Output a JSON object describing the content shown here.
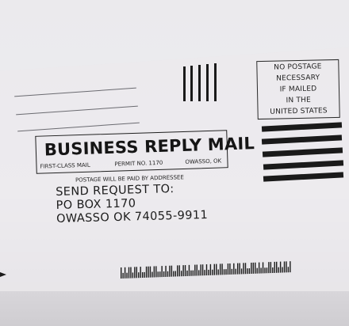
{
  "postage_box": {
    "lines": [
      "NO POSTAGE",
      "NECESSARY",
      "IF MAILED",
      "IN THE",
      "UNITED STATES"
    ]
  },
  "brm": {
    "title": "BUSINESS REPLY MAIL",
    "class": "FIRST-CLASS MAIL",
    "permit": "PERMIT NO. 1170",
    "city": "OWASSO, OK"
  },
  "postage_paid": "POSTAGE WILL BE PAID BY ADDRESSEE",
  "address": {
    "line1": "SEND REQUEST TO:",
    "line2": "PO BOX 1170",
    "line3": "OWASSO OK 74055-9911"
  }
}
